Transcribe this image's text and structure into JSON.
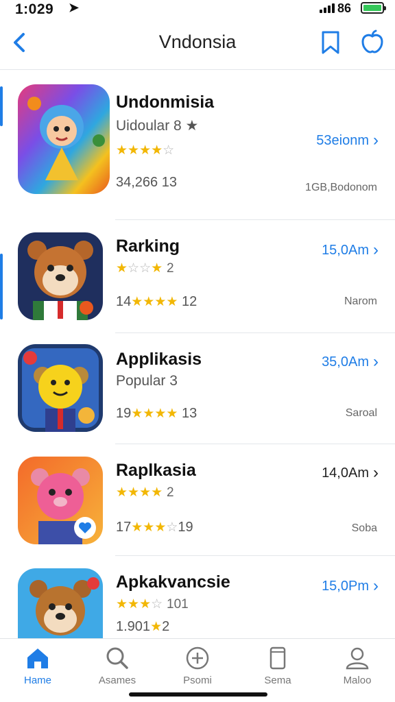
{
  "status_bar": {
    "time": "1:029",
    "carrier": "86",
    "battery_color": "#34c759"
  },
  "nav": {
    "title": "Vndonsia",
    "icons": [
      "back-chevron-icon",
      "bookmark-icon",
      "apple-icon"
    ]
  },
  "accent_color": "#1f7de6",
  "apps": [
    {
      "title": "Undonmisia",
      "subtitle": "Uidoular 8 ★",
      "stars": "★★★★",
      "stars_empty": "☆",
      "rating_count": "",
      "meta_left": "34,266 13",
      "price": "53eionm",
      "meta_right": "1GB,Bodonom"
    },
    {
      "title": "Rarking",
      "subtitle": "",
      "stars": "★",
      "stars_empty": "☆☆",
      "stars_tail": "★",
      "rating_count": "2",
      "meta_left": "14",
      "meta_stars": "★★★★",
      "meta_count": "12",
      "price": "15,0Am",
      "meta_right": "Narom"
    },
    {
      "title": "Applikasis",
      "subtitle": "Popular 3",
      "meta_left": "19",
      "meta_stars": "★★★★",
      "meta_count": "13",
      "price": "35,0Am",
      "meta_right": "Saroal"
    },
    {
      "title": "Raplkasia",
      "stars": "★★★★",
      "rating_count": "2",
      "meta_left": "17",
      "meta_stars": "★★★",
      "meta_stars_empty": "☆",
      "meta_count": "19",
      "price": "14,0Am",
      "meta_right": "Soba"
    },
    {
      "title": "Apkakvancsie",
      "stars": "★★★",
      "stars_empty": "☆",
      "rating_count": "101",
      "meta_left": "1.901",
      "meta_stars": "★",
      "meta_count": "2",
      "price": "15,0Pm"
    }
  ],
  "tabs": [
    {
      "label": "Hame",
      "icon": "home-icon",
      "active": true
    },
    {
      "label": "Asames",
      "icon": "search-icon",
      "active": false
    },
    {
      "label": "Psomi",
      "icon": "plus-circle-icon",
      "active": false
    },
    {
      "label": "Sema",
      "icon": "device-icon",
      "active": false
    },
    {
      "label": "Maloo",
      "icon": "person-icon",
      "active": false
    }
  ]
}
